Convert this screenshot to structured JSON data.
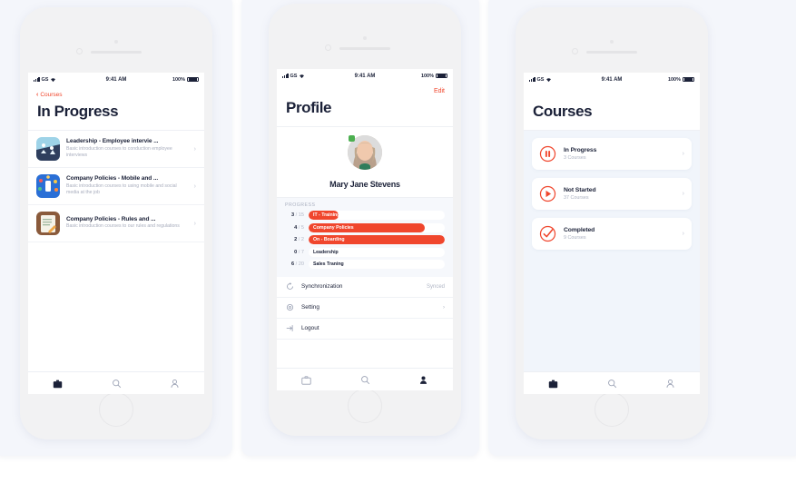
{
  "colors": {
    "accent": "#f0462d",
    "dark": "#1b2138",
    "muted": "#a8adbd",
    "panel_bg": "#f4f6fb",
    "cards_bg": "#f1f5fb"
  },
  "status_bar": {
    "carrier": "GS",
    "time": "9:41 AM",
    "battery": "100%"
  },
  "screen1": {
    "back_label": "Courses",
    "title": "In Progress",
    "courses": [
      {
        "title": "Leadership - Employee intervie ...",
        "subtitle": "Basic introduction courses to conduction employee interviews",
        "thumb": "leadership-thumb"
      },
      {
        "title": "Company Policies - Mobile and ...",
        "subtitle": "Basic introduction courses to using mobile and social media at the job",
        "thumb": "mobile-social-thumb"
      },
      {
        "title": "Company Policies - Rules and ...",
        "subtitle": "Basic introduction courses to our rules and regulations",
        "thumb": "rules-thumb"
      }
    ],
    "tabs": [
      {
        "icon": "briefcase-icon",
        "active": true
      },
      {
        "icon": "search-icon",
        "active": false
      },
      {
        "icon": "person-icon",
        "active": false
      }
    ]
  },
  "screen2": {
    "edit_label": "Edit",
    "title": "Profile",
    "user_name": "Mary Jane Stevens",
    "progress_label": "PROGRESS",
    "progress": [
      {
        "label": "IT - Training",
        "current": "3",
        "total": "15",
        "percent": 22
      },
      {
        "label": "Company Policies",
        "current": "4",
        "total": "5",
        "percent": 85
      },
      {
        "label": "On - Boarding",
        "current": "2",
        "total": "2",
        "percent": 100
      },
      {
        "label": "Leadership",
        "current": "0",
        "total": "7",
        "percent": 0
      },
      {
        "label": "Sales Traning",
        "current": "6",
        "total": "20",
        "percent": 0
      }
    ],
    "settings": [
      {
        "icon": "sync-icon",
        "label": "Synchronization",
        "value": "Synced"
      },
      {
        "icon": "gear-icon",
        "label": "Setting",
        "value": "›"
      },
      {
        "icon": "logout-icon",
        "label": "Logout",
        "value": ""
      }
    ],
    "tabs": [
      {
        "icon": "briefcase-icon",
        "active": false
      },
      {
        "icon": "search-icon",
        "active": false
      },
      {
        "icon": "person-icon",
        "active": true
      }
    ]
  },
  "screen3": {
    "title": "Courses",
    "cards": [
      {
        "icon": "pause-circle-icon",
        "title": "In Progress",
        "subtitle": "3 Courses"
      },
      {
        "icon": "play-circle-icon",
        "title": "Not Started",
        "subtitle": "37 Courses"
      },
      {
        "icon": "check-circle-icon",
        "title": "Completed",
        "subtitle": "9 Courses"
      }
    ],
    "tabs": [
      {
        "icon": "briefcase-icon",
        "active": true
      },
      {
        "icon": "search-icon",
        "active": false
      },
      {
        "icon": "person-icon",
        "active": false
      }
    ]
  }
}
